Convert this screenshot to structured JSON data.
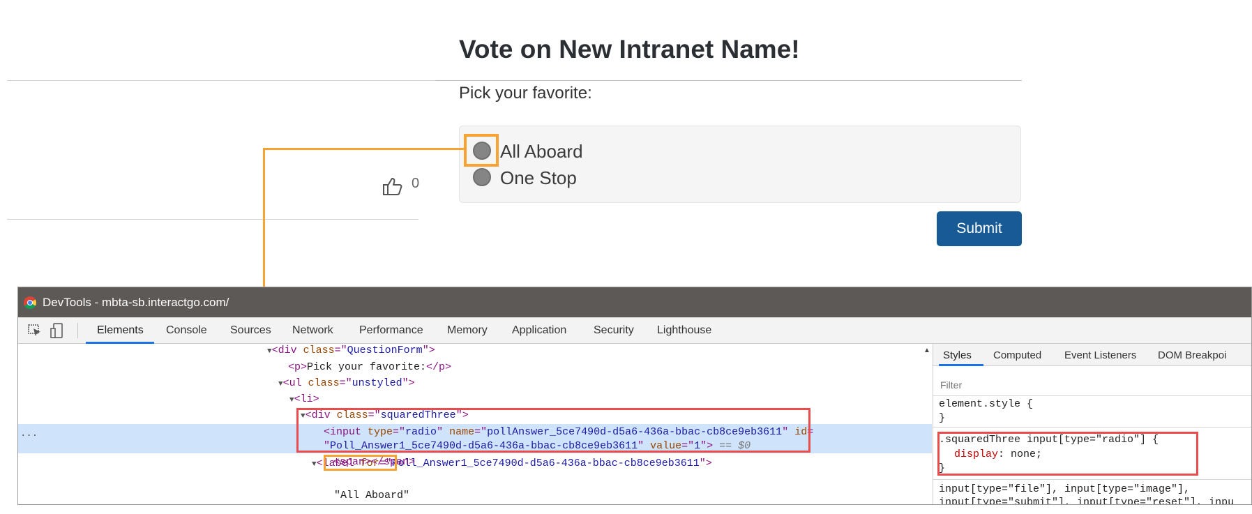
{
  "page": {
    "title": "Vote on New Intranet Name!",
    "prompt": "Pick your favorite:",
    "options": [
      {
        "label": "All Aboard"
      },
      {
        "label": "One Stop"
      }
    ],
    "submit_label": "Submit",
    "like_count": "0"
  },
  "devtools": {
    "window_title": "DevTools - mbta-sb.interactgo.com/",
    "tabs": [
      "Elements",
      "Console",
      "Sources",
      "Network",
      "Performance",
      "Memory",
      "Application",
      "Security",
      "Lighthouse"
    ],
    "active_tab": "Elements",
    "dom_lines": {
      "l1_tag_open": "<div ",
      "l1_attr": "class",
      "l1_eq": "=\"",
      "l1_val": "QuestionForm",
      "l1_close": "\">",
      "l2_open": "<p>",
      "l2_text": "Pick your favorite:",
      "l2_close": "</p>",
      "l3_tag_open": "<ul ",
      "l3_attr": "class",
      "l3_val": "unstyled",
      "l4_tag": "<li>",
      "l5_tag_open": "<div ",
      "l5_attr": "class",
      "l5_val": "squaredThree",
      "l6_tag_open": "<input ",
      "l6_attr1": "type",
      "l6_val1": "radio",
      "l6_attr2": "name",
      "l6_val2": "pollAnswer_5ce7490d-d5a6-436a-bbac-cb8ce9eb3611",
      "l6_attr3": "id",
      "l7_val3": "Poll_Answer1_5ce7490d-d5a6-436a-bbac-cb8ce9eb3611",
      "l7_attr4": "value",
      "l7_val4": "1",
      "l7_suffix": " == $0",
      "l8_tag_open": "<label ",
      "l8_attr": "for",
      "l8_val": "Poll_Answer1_5ce7490d-d5a6-436a-bbac-cb8ce9eb3611",
      "l9_span": "<span></span>",
      "l10_text": "\"All Aboard\"",
      "dots": "..."
    },
    "styles": {
      "tabs": [
        "Styles",
        "Computed",
        "Event Listeners",
        "DOM Breakpoi"
      ],
      "filter_placeholder": "Filter",
      "rule1_selector": "element.style {",
      "rule1_close": "}",
      "rule2_selector": ".squaredThree input[type=\"radio\"] {",
      "rule2_prop": "display",
      "rule2_value": ": none;",
      "rule2_close": "}",
      "rule3_line1": "input[type=\"file\"], input[type=\"image\"],",
      "rule3_line2": "input[type=\"submit\"], input[type=\"reset\"], inpu"
    }
  },
  "colors": {
    "accent_orange": "#f8a331",
    "highlight_red": "#e84c4c",
    "submit_blue": "#175a95",
    "devtools_titlebar": "#5d5957"
  }
}
